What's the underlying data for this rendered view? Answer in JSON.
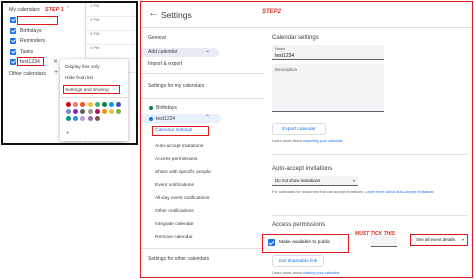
{
  "step1": {
    "my_calendars": "My calendars",
    "step_label": "STEP 1",
    "calendars": [
      {
        "label": "",
        "color": "#1a73e8"
      },
      {
        "label": "Birthdays",
        "color": "#1a73e8"
      },
      {
        "label": "Reminders",
        "color": "#1a73e8"
      },
      {
        "label": "Tasks",
        "color": "#1a73e8"
      },
      {
        "label": "test1234",
        "color": "#1a73e8"
      }
    ],
    "other_calendars": "Other calendars",
    "grid_labels": [
      "1 PM",
      "2 PM",
      "3 PM",
      "4 PM",
      "5 PM"
    ],
    "menu": {
      "items": [
        "Display this only",
        "Hide from list",
        "Settings and sharing"
      ],
      "swatches": [
        "#d50000",
        "#e67c73",
        "#f4511e",
        "#f6bf26",
        "#33b679",
        "#0b8043",
        "#039be5",
        "#3f51b5",
        "#7986cb",
        "#8e24aa",
        "#616161",
        "#a79b8e",
        "#ad1457",
        "#f09300",
        "#e4c441",
        "#7cb342",
        "#009688",
        "#4285f4",
        "#b39ddb",
        "#9e69af",
        "#795548"
      ]
    }
  },
  "step2": {
    "title": "Settings",
    "step_label": "STEP2",
    "nav": {
      "general": "General",
      "add_calendar": "Add calendar",
      "import_export": "Import & export",
      "settings_for_my_calendars": "Settings for my calendars",
      "birthdays": "Birthdays",
      "test_calendar": "test1234",
      "sub_items": [
        "Calendar settings",
        "Auto-accept invitations",
        "Access permissions",
        "Share with specific people",
        "Event notifications",
        "All-day event notifications",
        "Other notifications",
        "Integrate calendar",
        "Remove calendar"
      ],
      "settings_for_other_calendars": "Settings for other calendars"
    },
    "calendar_settings": {
      "heading": "Calendar settings",
      "name_label": "Name",
      "name_value": "test1234",
      "description_label": "Description",
      "export_button": "Export calendar",
      "export_hint": "Learn more about ",
      "export_hint_link": "exporting your calendar"
    },
    "auto_accept": {
      "heading": "Auto-accept invitations",
      "select_value": "Do not show invitations",
      "hint": "For calendars for resources that can accept invitations. ",
      "hint_link": "Learn more about auto-accept invitations"
    },
    "access": {
      "heading": "Access permissions",
      "must_tick": "MUST TICK THIS",
      "make_public": "Make available to public",
      "detail_select": "See all event details",
      "share_button": "Get shareable link",
      "share_hint": "Learn more about ",
      "share_hint_link": "sharing your calendar"
    }
  }
}
